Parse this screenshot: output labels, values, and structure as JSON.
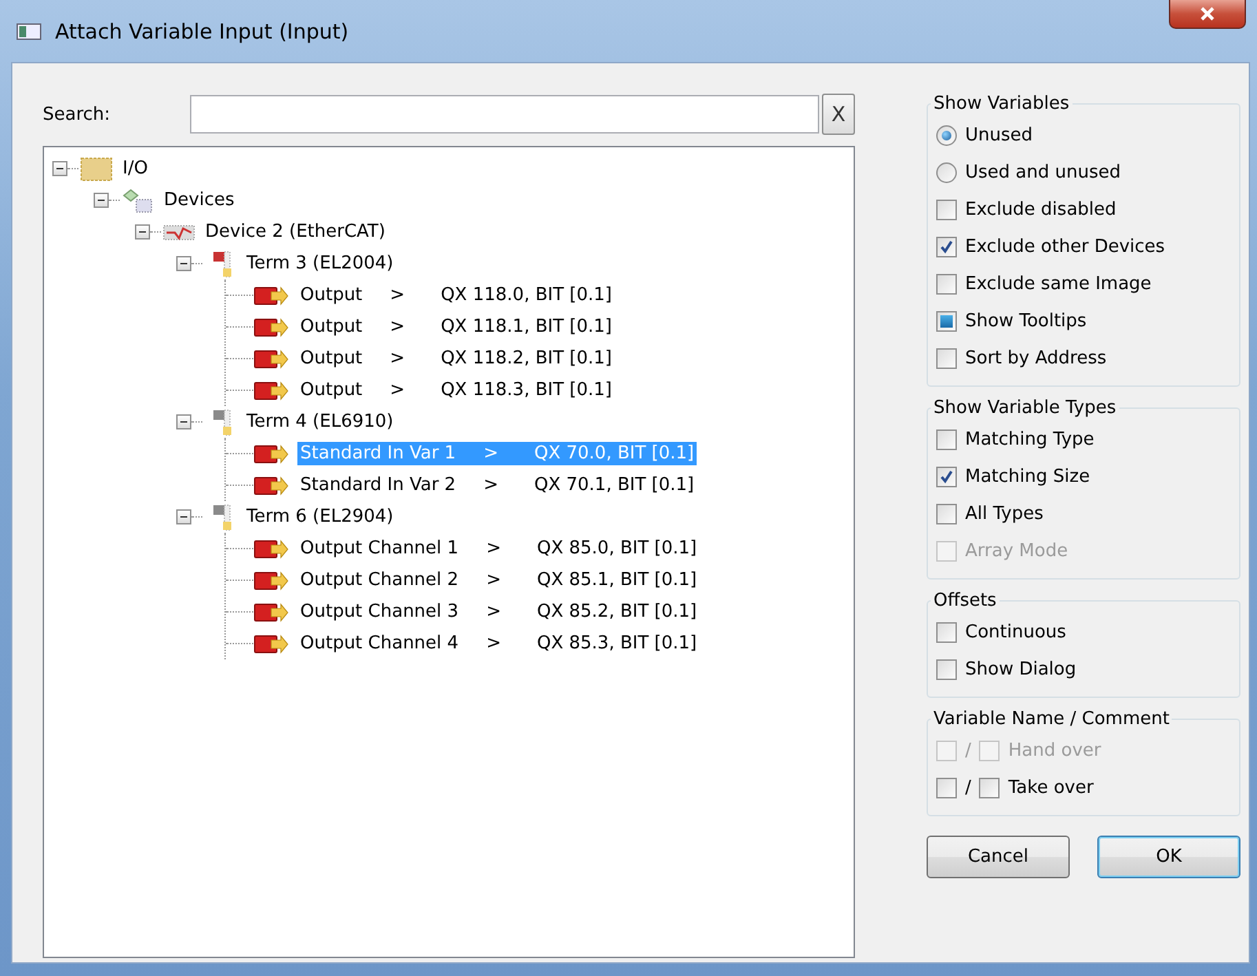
{
  "window": {
    "title": "Attach Variable Input (Input)"
  },
  "search": {
    "label": "Search:",
    "clear_label": "X"
  },
  "tree": [
    {
      "kind": "io",
      "label": "I/O",
      "expanded": true,
      "children": [
        {
          "kind": "devices",
          "label": "Devices",
          "expanded": true,
          "children": [
            {
              "kind": "ethercat",
              "label": "Device 2 (EtherCAT)",
              "expanded": true,
              "children": [
                {
                  "kind": "terminal",
                  "label": "Term 3 (EL2004)",
                  "color": "#c83232",
                  "expanded": true,
                  "leaves": [
                    {
                      "name": "Output",
                      "arrow": ">",
                      "address": "QX 118.0, BIT [0.1]",
                      "selected": false
                    },
                    {
                      "name": "Output",
                      "arrow": ">",
                      "address": "QX 118.1, BIT [0.1]",
                      "selected": false
                    },
                    {
                      "name": "Output",
                      "arrow": ">",
                      "address": "QX 118.2, BIT [0.1]",
                      "selected": false
                    },
                    {
                      "name": "Output",
                      "arrow": ">",
                      "address": "QX 118.3, BIT [0.1]",
                      "selected": false
                    }
                  ]
                },
                {
                  "kind": "terminal",
                  "label": "Term 4 (EL6910)",
                  "color": "#8a8a8a",
                  "expanded": true,
                  "leaves": [
                    {
                      "name": "Standard In Var 1",
                      "arrow": ">",
                      "address": "QX 70.0, BIT [0.1]",
                      "selected": true
                    },
                    {
                      "name": "Standard In Var 2",
                      "arrow": ">",
                      "address": "QX 70.1, BIT [0.1]",
                      "selected": false
                    }
                  ]
                },
                {
                  "kind": "terminal",
                  "label": "Term 6 (EL2904)",
                  "color": "#8a8a8a",
                  "expanded": true,
                  "leaves": [
                    {
                      "name": "Output Channel 1",
                      "arrow": ">",
                      "address": "QX 85.0, BIT [0.1]",
                      "selected": false
                    },
                    {
                      "name": "Output Channel 2",
                      "arrow": ">",
                      "address": "QX 85.1, BIT [0.1]",
                      "selected": false
                    },
                    {
                      "name": "Output Channel 3",
                      "arrow": ">",
                      "address": "QX 85.2, BIT [0.1]",
                      "selected": false
                    },
                    {
                      "name": "Output Channel 4",
                      "arrow": ">",
                      "address": "QX 85.3, BIT [0.1]",
                      "selected": false
                    }
                  ]
                }
              ]
            }
          ]
        }
      ]
    }
  ],
  "groups": [
    {
      "title": "Show Variables",
      "items": [
        {
          "kind": "radio",
          "label": "Unused",
          "selected": true,
          "disabled": false
        },
        {
          "kind": "radio",
          "label": "Used and unused",
          "selected": false,
          "disabled": false
        },
        {
          "kind": "checkbox",
          "label": "Exclude disabled",
          "checked": false,
          "indeterminate": false,
          "disabled": false
        },
        {
          "kind": "checkbox",
          "label": "Exclude other Devices",
          "checked": true,
          "indeterminate": false,
          "disabled": false
        },
        {
          "kind": "checkbox",
          "label": "Exclude same Image",
          "checked": false,
          "indeterminate": false,
          "disabled": false
        },
        {
          "kind": "checkbox",
          "label": "Show Tooltips",
          "checked": true,
          "indeterminate": true,
          "disabled": false
        },
        {
          "kind": "checkbox",
          "label": "Sort by Address",
          "checked": false,
          "indeterminate": false,
          "disabled": false
        }
      ]
    },
    {
      "title": "Show Variable Types",
      "items": [
        {
          "kind": "checkbox",
          "label": "Matching Type",
          "checked": false,
          "indeterminate": false,
          "disabled": false
        },
        {
          "kind": "checkbox",
          "label": "Matching Size",
          "checked": true,
          "indeterminate": false,
          "disabled": false
        },
        {
          "kind": "checkbox",
          "label": "All Types",
          "checked": false,
          "indeterminate": false,
          "disabled": false
        },
        {
          "kind": "checkbox",
          "label": "Array Mode",
          "checked": false,
          "indeterminate": false,
          "disabled": true
        }
      ]
    },
    {
      "title": "Offsets",
      "items": [
        {
          "kind": "checkbox",
          "label": "Continuous",
          "checked": false,
          "indeterminate": false,
          "disabled": false
        },
        {
          "kind": "checkbox",
          "label": "Show Dialog",
          "checked": false,
          "indeterminate": false,
          "disabled": false
        }
      ]
    },
    {
      "title": "Variable Name / Comment",
      "items": [
        {
          "kind": "pair",
          "separator": "/",
          "label": "Hand over",
          "first_checked": false,
          "second_checked": false,
          "disabled": true
        },
        {
          "kind": "pair",
          "separator": "/",
          "label": "Take over",
          "first_checked": false,
          "second_checked": false,
          "disabled": false
        }
      ]
    }
  ],
  "buttons": [
    {
      "label": "Cancel",
      "default": false
    },
    {
      "label": "OK",
      "default": true
    }
  ]
}
